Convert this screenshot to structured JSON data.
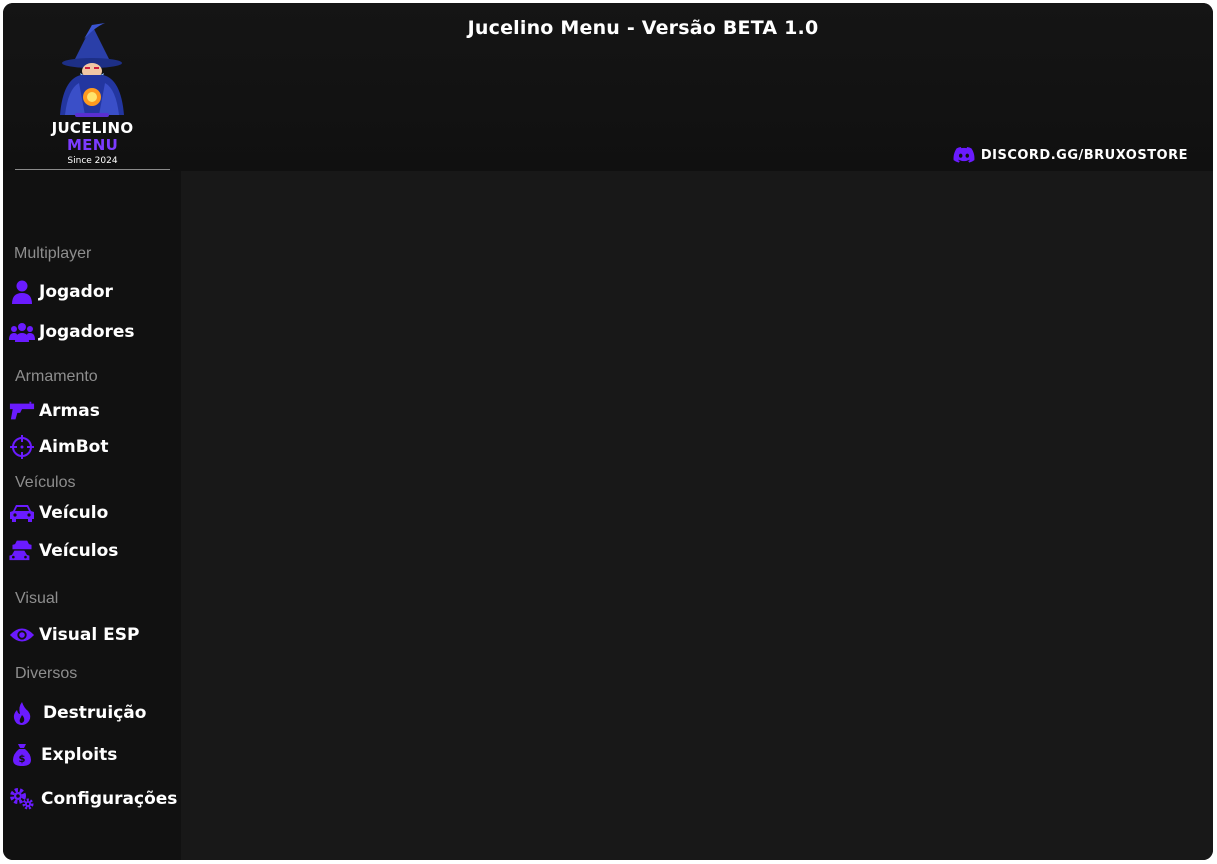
{
  "window": {
    "title": "Jucelino Menu - Versão BETA 1.0"
  },
  "logo": {
    "line1": "JUCELINO",
    "line2": "MENU",
    "line3": "Since 2024"
  },
  "discord": {
    "label": "DISCORD.GG/BRUXOSTORE",
    "icon": "discord-icon"
  },
  "colors": {
    "accent": "#6a1bff",
    "background": "#111111",
    "content": "#181818",
    "section_text": "#8e8e8e"
  },
  "sidebar": {
    "sections": [
      {
        "title": "Multiplayer",
        "items": [
          {
            "label": "Jogador",
            "icon": "user-icon"
          },
          {
            "label": "Jogadores",
            "icon": "users-icon"
          }
        ]
      },
      {
        "title": "Armamento",
        "items": [
          {
            "label": "Armas",
            "icon": "gun-icon"
          },
          {
            "label": "AimBot",
            "icon": "crosshair-icon"
          }
        ]
      },
      {
        "title": "Veículos",
        "items": [
          {
            "label": "Veículo",
            "icon": "car-icon"
          },
          {
            "label": "Veículos",
            "icon": "cars-icon"
          }
        ]
      },
      {
        "title": "Visual",
        "items": [
          {
            "label": "Visual ESP",
            "icon": "eye-icon"
          }
        ]
      },
      {
        "title": "Diversos",
        "items": [
          {
            "label": "Destruição",
            "icon": "fire-icon"
          },
          {
            "label": "Exploits",
            "icon": "money-bag-icon"
          },
          {
            "label": "Configurações",
            "icon": "gears-icon"
          }
        ]
      }
    ]
  }
}
